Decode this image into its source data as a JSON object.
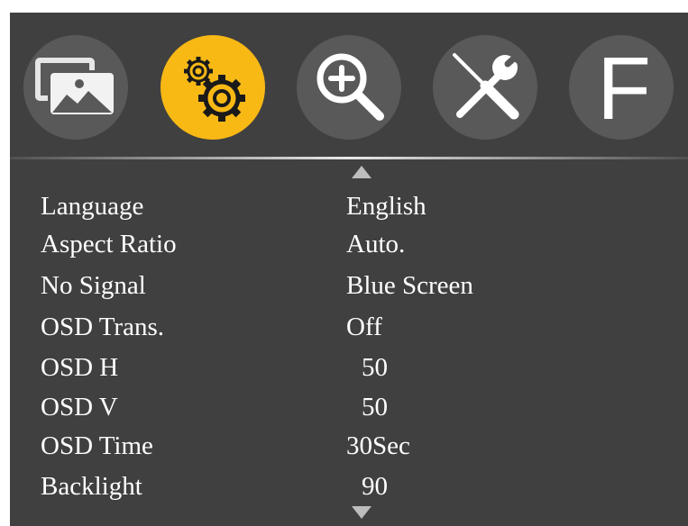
{
  "tabs": [
    {
      "name": "picture",
      "icon": "image-icon",
      "active": false
    },
    {
      "name": "settings",
      "icon": "gears-icon",
      "active": true
    },
    {
      "name": "zoom",
      "icon": "zoom-in-icon",
      "active": false
    },
    {
      "name": "tools",
      "icon": "wrench-screwdriver-icon",
      "active": false
    },
    {
      "name": "factory",
      "icon": "letter-f-icon",
      "letter": "F",
      "active": false
    }
  ],
  "colors": {
    "panel_bg": "#404040",
    "tab_bg": "#595959",
    "active_tab": "#f9b915",
    "text": "#ffffff",
    "arrow": "#bdbdbd"
  },
  "menu": {
    "items": [
      {
        "label": "Language",
        "value": "English"
      },
      {
        "label": "Aspect Ratio",
        "value": "Auto."
      },
      {
        "label": "No Signal",
        "value": "Blue Screen"
      },
      {
        "label": "OSD Trans.",
        "value": "Off"
      },
      {
        "label": "OSD H",
        "value": "50"
      },
      {
        "label": "OSD V",
        "value": "50"
      },
      {
        "label": "OSD Time",
        "value": "30Sec"
      },
      {
        "label": "Backlight",
        "value": "90"
      }
    ]
  },
  "scroll": {
    "up_icon": "triangle-up-icon",
    "down_icon": "triangle-down-icon"
  }
}
